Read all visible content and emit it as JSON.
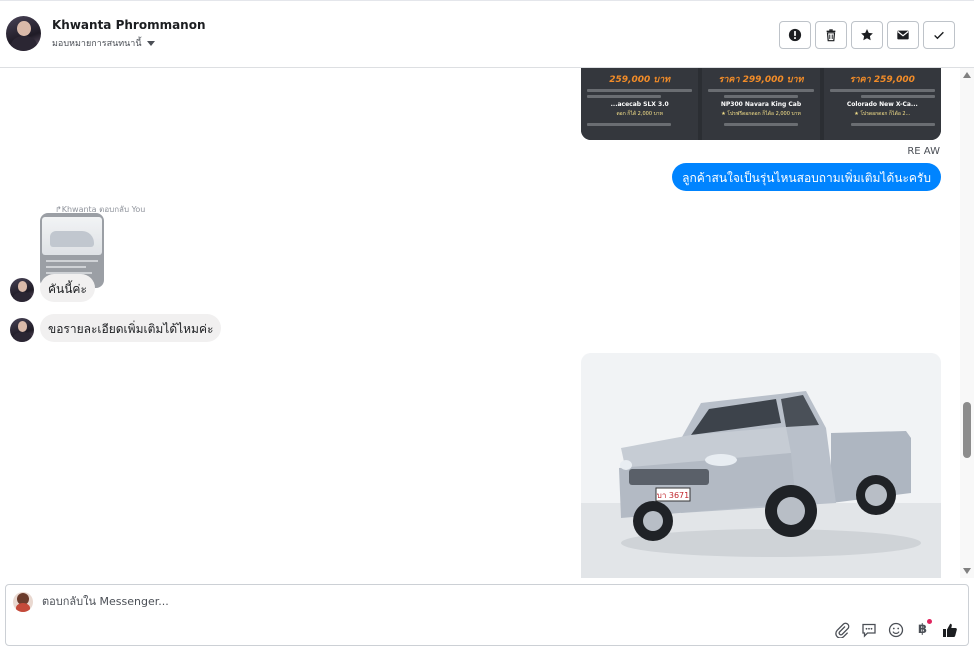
{
  "header": {
    "contact_name": "Khwanta Phrommanon",
    "assign_label": "มอบหมายการสนทนานี้",
    "actions": [
      {
        "name": "report-icon"
      },
      {
        "name": "trash-icon"
      },
      {
        "name": "star-icon"
      },
      {
        "name": "envelope-icon"
      },
      {
        "name": "check-icon"
      }
    ]
  },
  "conversation": {
    "promo_cards": [
      {
        "price": "259,000 บาท",
        "model": "...acecab SLX 3.0",
        "tag": "ดอก ก็ได้ 2,000 บาท"
      },
      {
        "price": "ราคา 299,000 บาท",
        "model": "NP300 Navara King Cab",
        "tag": "★ โปรฟรีดอกดอก ก็ได้อ 2,000 บาท"
      },
      {
        "price": "ราคา 259,000",
        "model": "Colorado New X-Ca...",
        "tag": "★ โปรดอกดอก ก็ได้อ 2..."
      }
    ],
    "outgoing_sender": "RE AW",
    "outgoing_text": "ลูกค้าสนใจเป็นรุ่นไหนสอบถามเพิ่มเติมได้นะครับ",
    "reply_label": "↱Khwanta ตอบกลับ You",
    "incoming_1": "คันนี้ค่ะ",
    "incoming_2": "ขอรายละเอียดเพิ่มเติมได้ไหมค่ะ",
    "truck_plate": "บา 3671"
  },
  "composer": {
    "placeholder": "ตอบกลับใน Messenger...",
    "baht_symbol": "฿",
    "tools": [
      "paperclip-icon",
      "chat-bubble-icon",
      "emoji-icon",
      "baht-icon",
      "thumbs-up-icon"
    ]
  },
  "colors": {
    "outgoing_bubble": "#0084ff",
    "incoming_bubble": "#f1f0f0",
    "thumbs_up": "#1c1e21"
  }
}
